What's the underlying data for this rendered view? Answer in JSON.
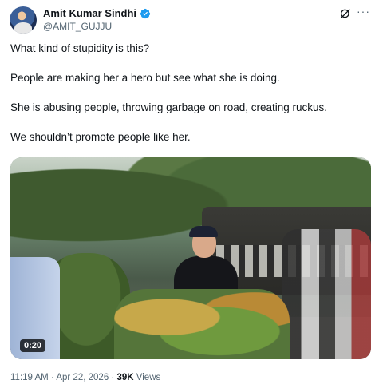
{
  "author": {
    "display_name": "Amit Kumar Sindhi",
    "handle": "@AMIT_GUJJU",
    "verified": true,
    "verified_color": "#1d9bf0"
  },
  "icons": {
    "grok": "grok-icon",
    "more": "more-icon"
  },
  "tweet": {
    "paragraphs": [
      "What kind of stupidity is this?",
      "People are making her a hero but see what she is doing.",
      "She is abusing people, throwing garbage on road, creating ruckus.",
      "We shouldn’t promote people like her."
    ]
  },
  "media": {
    "type": "video",
    "duration": "0:20"
  },
  "meta": {
    "time": "11:19 AM",
    "separator": "·",
    "date": "Apr 22, 2026",
    "views_count": "39K",
    "views_label": "Views"
  }
}
